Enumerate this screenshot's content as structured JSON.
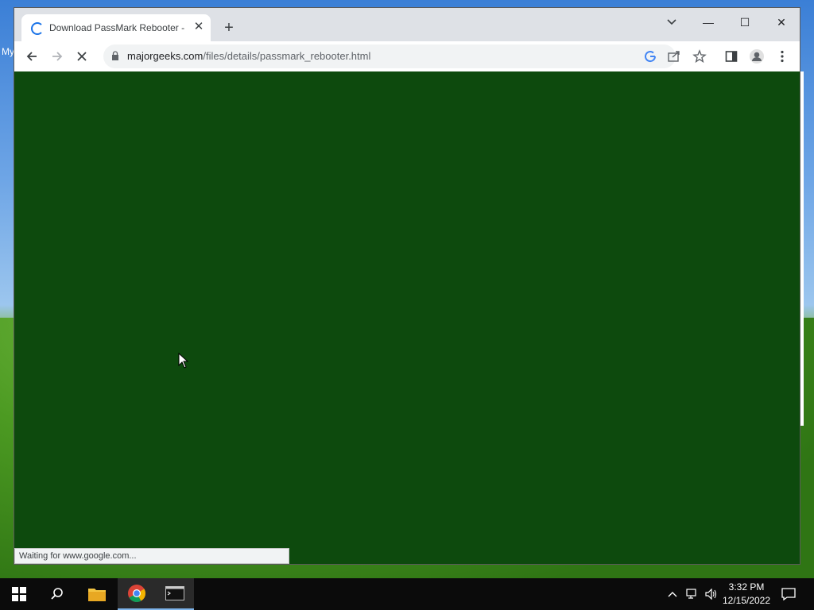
{
  "desktop": {
    "icon_label_partial": "My"
  },
  "browser": {
    "tab": {
      "title": "Download PassMark Rebooter - ",
      "close_symbol": "✕",
      "loading": true
    },
    "new_tab_symbol": "+",
    "window_controls": {
      "minimize": "—",
      "maximize": "☐",
      "close": "✕"
    },
    "address": {
      "host": "majorgeeks.com",
      "path": "/files/details/passmark_rebooter.html"
    },
    "status_text": "Waiting for www.google.com...",
    "colors": {
      "content_bg": "#0d4a0d",
      "accent": "#1a73e8"
    }
  },
  "taskbar": {
    "items": [
      "start-icon",
      "search-icon",
      "file-explorer-icon",
      "chrome-icon",
      "terminal-icon"
    ],
    "clock": {
      "time": "3:32 PM",
      "date": "12/15/2022"
    }
  }
}
